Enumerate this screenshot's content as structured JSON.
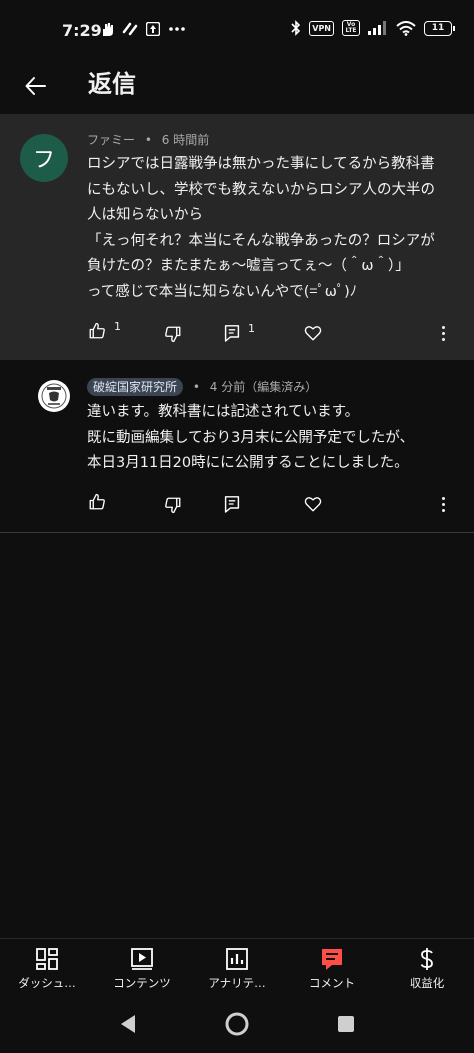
{
  "status_bar": {
    "time": "7:29",
    "battery": "11",
    "vpn": "VPN",
    "volte": "Vo LTE"
  },
  "header": {
    "title": "返信"
  },
  "parent": {
    "avatar_letter": "フ",
    "author": "ファミー",
    "separator": "•",
    "time": "6 時間前",
    "text": "ロシアでは日露戦争は無かった事にしてるから教科書\nにもないし、学校でも教えないからロシア人の大半の\n人は知らないから\n「えっ何それ？本当にそんな戦争あったの？ロシアが\n負けたの？またまたぁ〜嘘言ってぇ〜（＾ω＾）」\nって感じで本当に知らないんやで(=ﾟωﾟ)ﾉ",
    "like_count": "1",
    "reply_count": "1"
  },
  "reply": {
    "author": "破綻国家研究所",
    "separator": "•",
    "time": "4 分前（編集済み）",
    "text": "違います。教科書には記述されています。\n既に動画編集しており3月末に公開予定でしたが、\n本日3月11日20時にに公開することにしました。"
  },
  "bottom_nav": {
    "items": [
      {
        "label": "ダッシュ…",
        "icon": "dashboard-icon"
      },
      {
        "label": "コンテンツ",
        "icon": "content-icon"
      },
      {
        "label": "アナリテ…",
        "icon": "analytics-icon"
      },
      {
        "label": "コメント",
        "icon": "comment-icon"
      },
      {
        "label": "収益化",
        "icon": "dollar-icon"
      }
    ]
  },
  "colors": {
    "accent": "#ff4e45",
    "parent_bg": "#272727",
    "avatar_bg": "#1e5c4a",
    "badge_bg": "#3a4453"
  }
}
